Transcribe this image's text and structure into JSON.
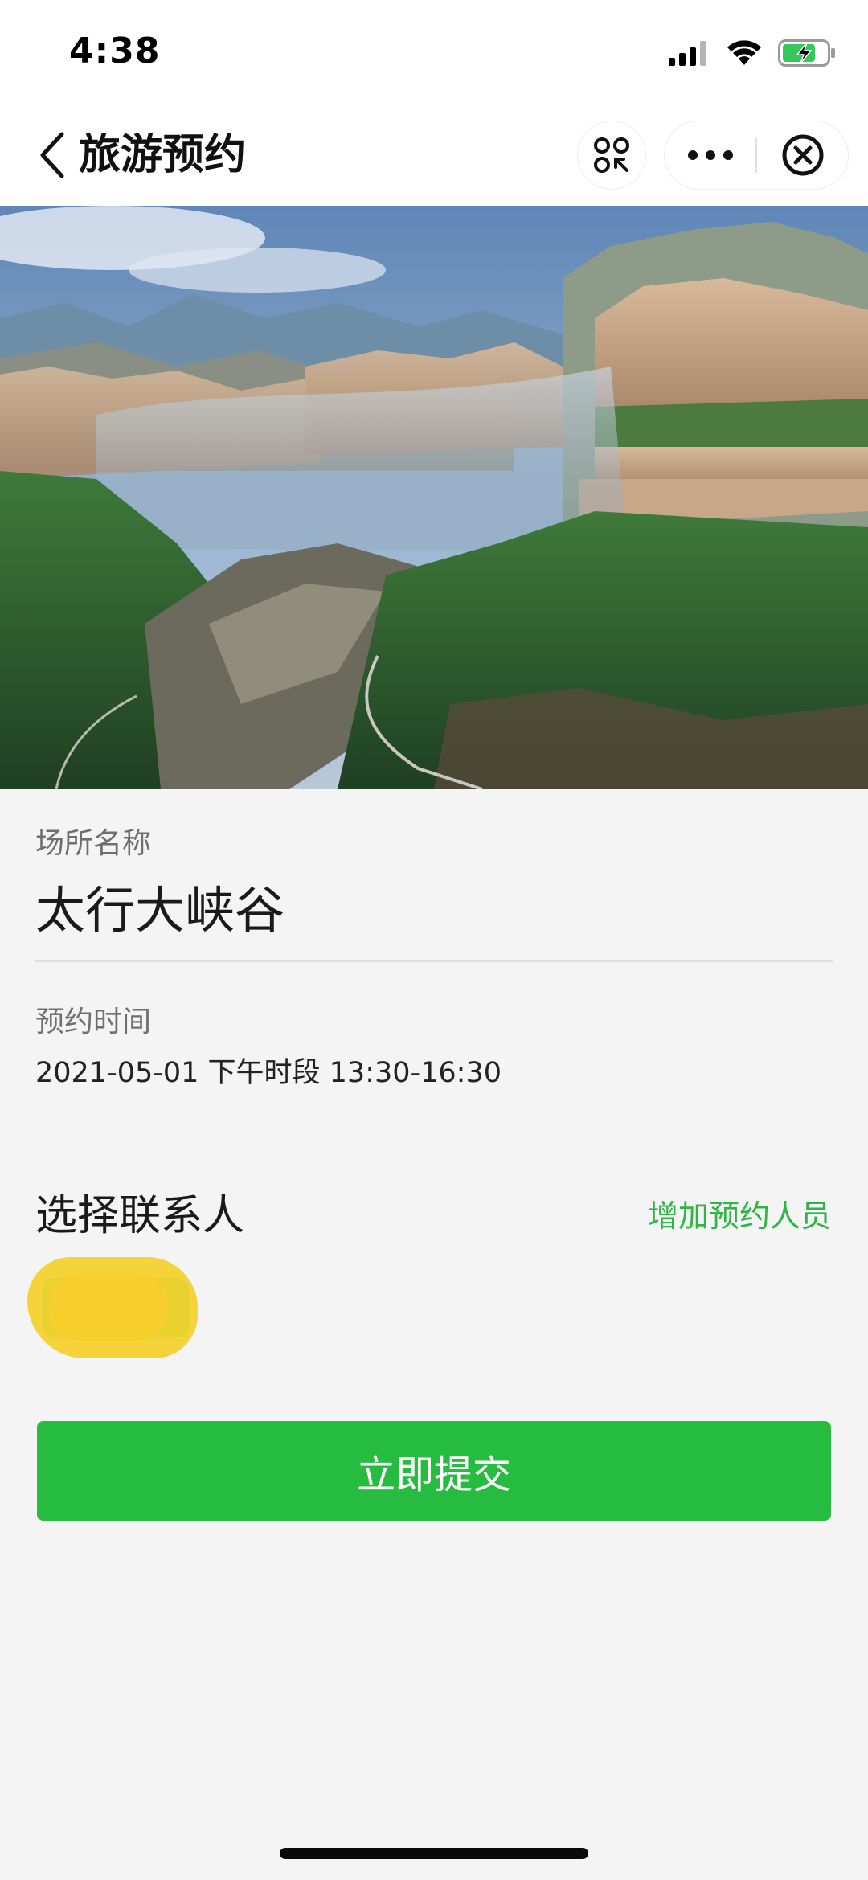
{
  "status_bar": {
    "time": "4:38"
  },
  "nav": {
    "title": "旅游预约",
    "back_icon": "chevron-left-icon",
    "scan_icon": "mini-program-scan-icon",
    "more_icon": "more-dots-icon",
    "close_icon": "close-circle-icon"
  },
  "hero": {
    "description_icon": "canyon-landscape-image"
  },
  "venue": {
    "label": "场所名称",
    "name": "太行大峡谷"
  },
  "booking_time": {
    "label": "预约时间",
    "value": "2021-05-01 下午时段 13:30-16:30"
  },
  "contact": {
    "title": "选择联系人",
    "add_label": "增加预约人员"
  },
  "submit": {
    "label": "立即提交"
  },
  "colors": {
    "accent_green": "#26bc3f",
    "link_green": "#2fb544",
    "background": "#f4f4f4"
  }
}
